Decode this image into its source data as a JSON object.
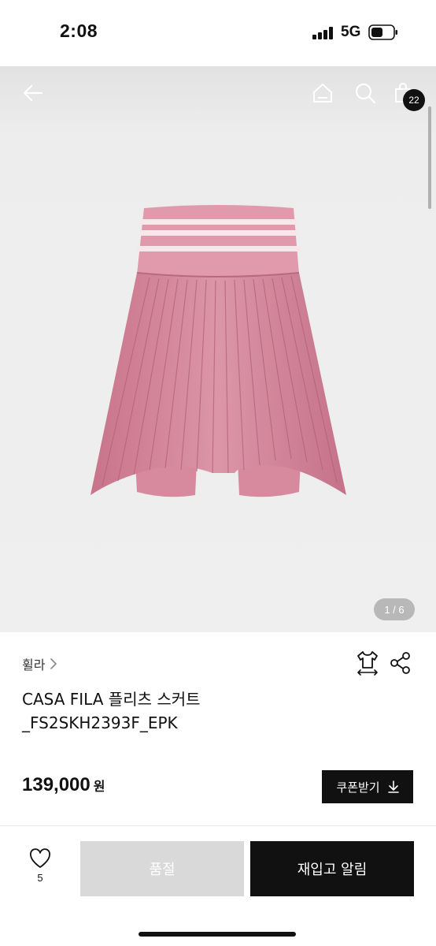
{
  "status_bar": {
    "time": "2:08",
    "network": "5G"
  },
  "gallery": {
    "cart_count": "22",
    "page_counter": "1 / 6",
    "image_alt": "pink pleated skirt"
  },
  "product": {
    "brand": "휠라",
    "title_line1": "CASA FILA 플리츠 스커트",
    "title_line2": "_FS2SKH2393F_EPK",
    "price": "139,000",
    "currency": "원",
    "coupon_label": "쿠폰받기"
  },
  "bottom_bar": {
    "like_count": "5",
    "soldout_label": "품절",
    "restock_label": "재입고 알림"
  },
  "colors": {
    "accent": "#111111",
    "disabled": "#d9d9d9",
    "product_pink": "#d98a9d"
  },
  "icons": {
    "back": "back-arrow-icon",
    "home": "home-icon",
    "search": "search-icon",
    "cart": "shopping-bag-icon",
    "size": "size-guide-icon",
    "share": "share-icon",
    "heart": "heart-icon",
    "download": "download-icon"
  }
}
